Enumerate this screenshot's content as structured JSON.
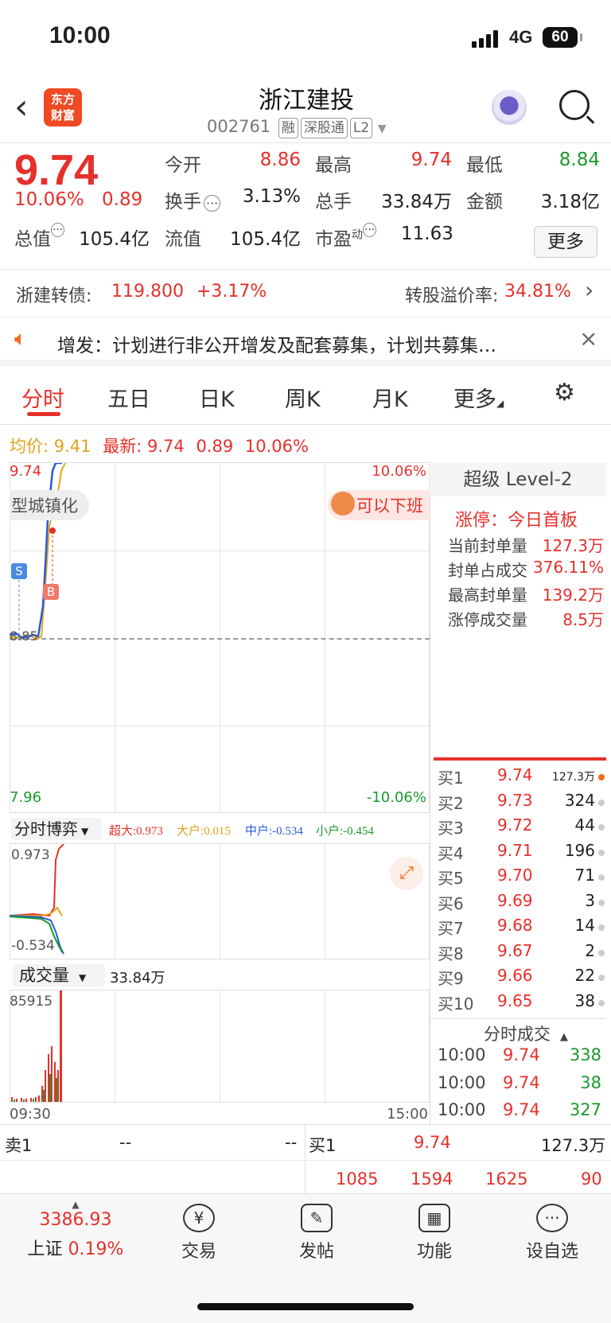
{
  "status": {
    "time": "10:00",
    "network": "4G",
    "battery": "60"
  },
  "header": {
    "logo": "东方财富",
    "name": "浙江建投",
    "code": "002761",
    "tags": [
      "融",
      "深股通",
      "L2"
    ]
  },
  "quote": {
    "price": "9.74",
    "pct": "10.06%",
    "change": "0.89",
    "open_lbl": "今开",
    "open": "8.86",
    "high_lbl": "最高",
    "high": "9.74",
    "low_lbl": "最低",
    "low": "8.84",
    "turn_lbl": "换手",
    "turn": "3.13%",
    "vol_lbl": "总手",
    "vol": "33.84万",
    "amt_lbl": "金额",
    "amt": "3.18亿",
    "mcap_lbl": "总值",
    "mcap": "105.4亿",
    "float_lbl": "流值",
    "float": "105.4亿",
    "pe_lbl": "市盈",
    "pe_sup": "动",
    "pe": "11.63",
    "more": "更多"
  },
  "bond": {
    "name": "浙建转债:",
    "price": "119.800",
    "pct": "+3.17%",
    "premium_lbl": "转股溢价率:",
    "premium": "34.81%"
  },
  "notice": {
    "text": "增发：计划进行非公开增发及配套募集，计划共募集…"
  },
  "tabs": [
    "分时",
    "五日",
    "日K",
    "周K",
    "月K",
    "更多"
  ],
  "avg": {
    "avg_lbl": "均价:",
    "avg": "9.41",
    "new_lbl": "最新:",
    "new": "9.74",
    "chg": "0.89",
    "pct": "10.06%"
  },
  "chart": {
    "top_left": "9.74",
    "top_right": "10.06%",
    "bottom_left": "7.96",
    "bottom_right": "-10.06%",
    "ref": "8.85",
    "tag_left": "型城镇化",
    "tag_right": "可以下班",
    "s": "S",
    "b": "B",
    "time_start": "09:30",
    "time_end": "15:00"
  },
  "game": {
    "select": "分时博弈",
    "super": "超大:0.973",
    "big": "大户:0.015",
    "mid": "中户:-0.534",
    "small": "小户:-0.454",
    "max": "0.973",
    "min": "-0.534"
  },
  "volume": {
    "select": "成交量",
    "total": "33.84万",
    "max": "85915"
  },
  "level2": {
    "title": "超级 Level-2",
    "limit": "涨停：今日首板",
    "rows": [
      [
        "当前封单量",
        "127.3万"
      ],
      [
        "封单占成交",
        "376.11%"
      ],
      [
        "最高封单量",
        "139.2万"
      ],
      [
        "涨停成交量",
        "8.5万"
      ]
    ]
  },
  "orderbook": [
    [
      "买1",
      "9.74",
      "127.3万"
    ],
    [
      "买2",
      "9.73",
      "324"
    ],
    [
      "买3",
      "9.72",
      "44"
    ],
    [
      "买4",
      "9.71",
      "196"
    ],
    [
      "买5",
      "9.70",
      "71"
    ],
    [
      "买6",
      "9.69",
      "3"
    ],
    [
      "买7",
      "9.68",
      "14"
    ],
    [
      "买8",
      "9.67",
      "2"
    ],
    [
      "买9",
      "9.66",
      "22"
    ],
    [
      "买10",
      "9.65",
      "38"
    ]
  ],
  "ticks": {
    "title": "分时成交",
    "rows": [
      [
        "10:00",
        "9.74",
        "338"
      ],
      [
        "10:00",
        "9.74",
        "38"
      ],
      [
        "10:00",
        "9.74",
        "327"
      ]
    ]
  },
  "bottom": {
    "sell_lbl": "卖1",
    "sell_p": "--",
    "sell_v": "--",
    "buy_lbl": "买1",
    "buy_p": "9.74",
    "buy_v": "127.3万",
    "vols": [
      "1085",
      "1594",
      "1625",
      "90"
    ]
  },
  "footer": {
    "index": "3386.93",
    "index_name": "上证",
    "index_pct": "0.19%",
    "items": [
      "交易",
      "发帖",
      "功能",
      "设自选"
    ]
  }
}
